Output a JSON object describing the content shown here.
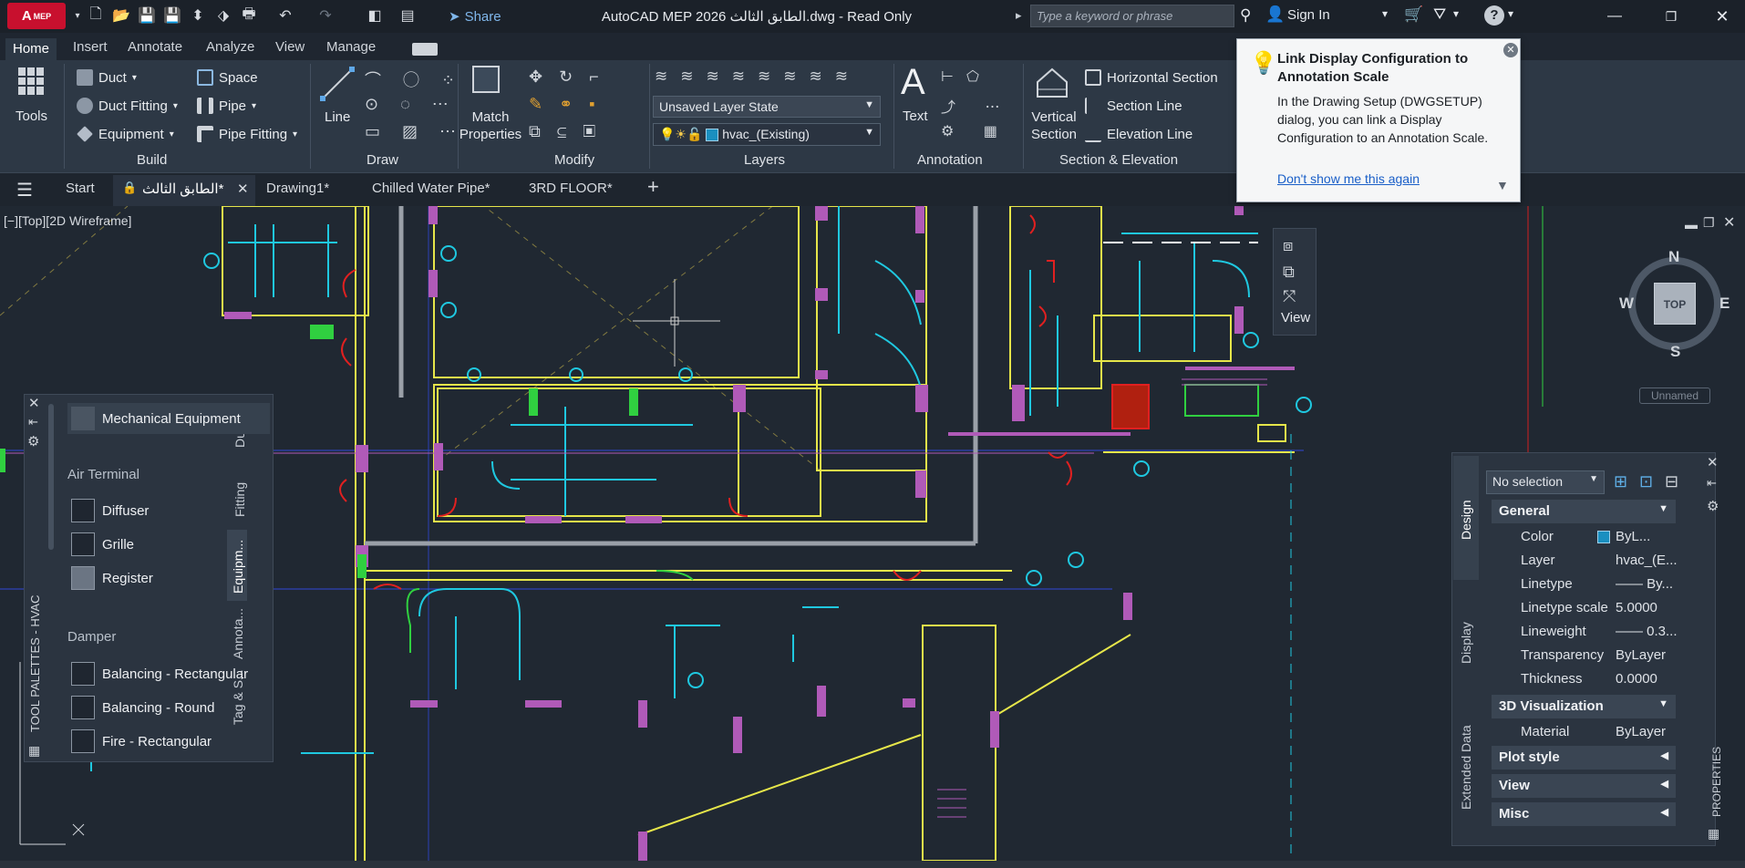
{
  "app": {
    "logo_text": "A",
    "logo_suffix": "MEP",
    "title": "AutoCAD MEP 2026   الطابق الثالث.dwg - Read Only",
    "share_label": "Share",
    "search_placeholder": "Type a keyword or phrase",
    "sign_in_label": "Sign In"
  },
  "ribbon_tabs": [
    "Home",
    "Insert",
    "Annotate",
    "Analyze",
    "View",
    "Manage"
  ],
  "ribbon": {
    "tools_label": "Tools",
    "build": {
      "title": "Build",
      "duct": "Duct",
      "duct_fitting": "Duct Fitting",
      "equipment": "Equipment",
      "space": "Space",
      "pipe": "Pipe",
      "pipe_fitting": "Pipe Fitting"
    },
    "draw": {
      "title": "Draw",
      "line": "Line"
    },
    "modify": {
      "title": "Modify",
      "match_properties": "Match Properties"
    },
    "layers": {
      "title": "Layers",
      "layer_state": "Unsaved Layer State",
      "current_layer": "hvac_(Existing)"
    },
    "annotation": {
      "title": "Annotation",
      "text": "Text"
    },
    "section": {
      "title": "Section & Elevation",
      "vertical_section": "Vertical Section",
      "horizontal_section": "Horizontal Section",
      "section_line": "Section Line",
      "elevation_line": "Elevation Line"
    }
  },
  "file_tabs": [
    "Start",
    "الطابق الثالث*",
    "Drawing1*",
    "Chilled Water Pipe*",
    "3RD FLOOR*"
  ],
  "viewport_label": "[−][Top][2D Wireframe]",
  "notification": {
    "title": "Link Display Configuration to Annotation Scale",
    "body": "In the Drawing Setup (DWGSETUP) dialog, you can link a Display Configuration to an Annotation Scale.",
    "link": "Don't show me this again"
  },
  "view_widget": {
    "label": "View"
  },
  "viewcube": {
    "n": "N",
    "s": "S",
    "e": "E",
    "w": "W",
    "top": "TOP",
    "ucs": "Unnamed"
  },
  "palette": {
    "title": "TOOL PALETTES - HVAC",
    "vertical_tabs": [
      "Duct",
      "Fitting",
      "Equipm...",
      "Annota...",
      "Tag & S..."
    ],
    "items": {
      "mech": "Mechanical Equipment",
      "air_terminal": "Air Terminal",
      "diffuser": "Diffuser",
      "grille": "Grille",
      "register": "Register",
      "damper": "Damper",
      "bal_rect": "Balancing - Rectangular",
      "bal_round": "Balancing - Round",
      "fire_rect": "Fire - Rectangular"
    }
  },
  "properties": {
    "title": "PROPERTIES",
    "selection": "No selection",
    "tabs": [
      "Design",
      "Display",
      "Extended Data"
    ],
    "general_header": "General",
    "rows": [
      {
        "label": "Color",
        "value": "ByL..."
      },
      {
        "label": "Layer",
        "value": "hvac_(E..."
      },
      {
        "label": "Linetype",
        "value": "—— By..."
      },
      {
        "label": "Linetype scale",
        "value": "5.0000"
      },
      {
        "label": "Lineweight",
        "value": "—— 0.3..."
      },
      {
        "label": "Transparency",
        "value": "ByLayer"
      },
      {
        "label": "Thickness",
        "value": "0.0000"
      }
    ],
    "viz_header": "3D Visualization",
    "material_label": "Material",
    "material_value": "ByLayer",
    "collapsed": [
      "Plot style",
      "View",
      "Misc"
    ]
  },
  "colors": {
    "accent": "#2d3845",
    "cad_yellow": "#e6e64a",
    "cad_cyan": "#1fc8e0",
    "cad_magenta": "#b05ab8",
    "cad_red": "#e02020"
  }
}
